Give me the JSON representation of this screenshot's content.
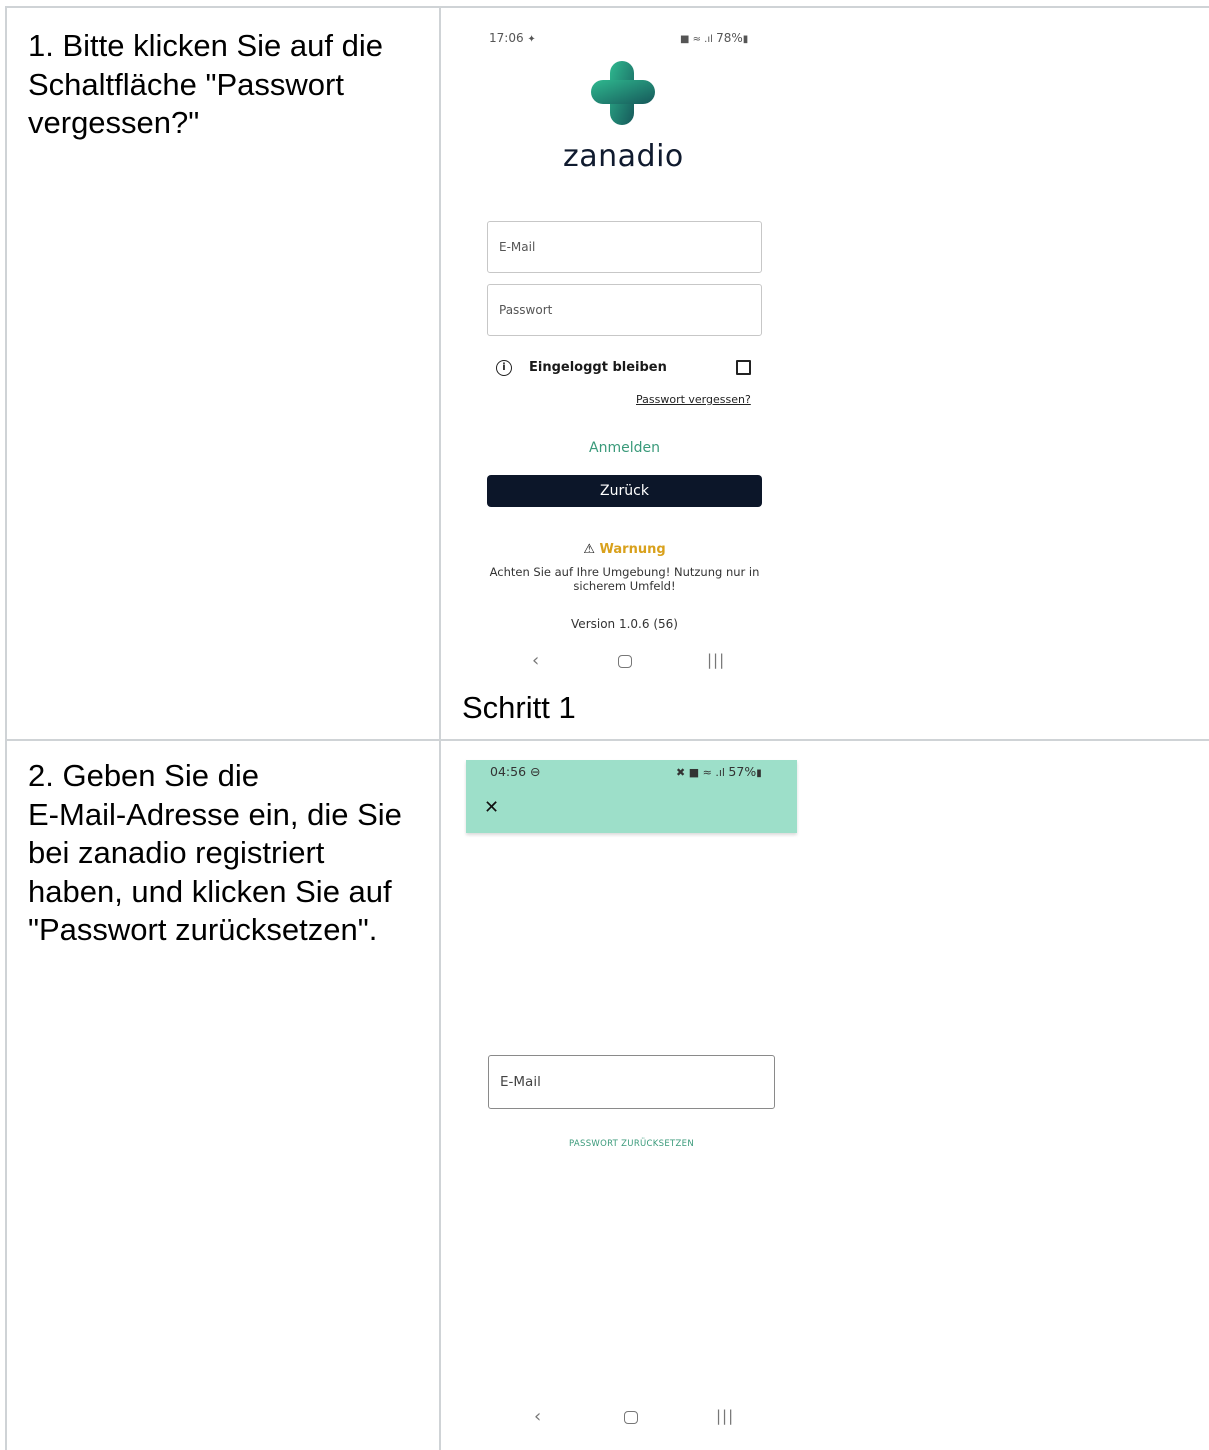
{
  "rows": [
    {
      "instruction_lines": [
        "1. Bitte klicken Sie auf die",
        "Schaltfläche \"Passwort",
        "vergessen?\""
      ],
      "caption": "Schritt 1",
      "screen": {
        "status_time": "17:06",
        "status_right": "78%",
        "app_name": "zanadio",
        "email_placeholder": "E-Mail",
        "password_placeholder": "Passwort",
        "remember_label": "Eingeloggt bleiben",
        "forgot_password": "Passwort vergessen?",
        "login_label": "Anmelden",
        "back_label": "Zurück",
        "warning_title": "Warnung",
        "warning_text_line1": "Achten Sie auf Ihre Umgebung! Nutzung nur in",
        "warning_text_line2": "sicherem Umfeld!",
        "version": "Version 1.0.6 (56)"
      }
    },
    {
      "instruction_lines": [
        "2. Geben Sie die",
        "E-Mail-Adresse ein, die Sie",
        "bei zanadio registriert",
        "haben, und klicken Sie auf",
        "\"Passwort zurücksetzen\"."
      ],
      "screen": {
        "status_time": "04:56",
        "status_right": "57%",
        "email_placeholder": "E-Mail",
        "reset_label": "PASSWORT ZURÜCKSETZEN"
      }
    }
  ],
  "colors": {
    "accent_green": "#3a9a7a",
    "header_green": "#9ddfc9",
    "button_dark": "#0c1629",
    "warning": "#d9a11c",
    "grid": "#cfd3d6"
  },
  "icons": [
    "info-icon",
    "checkbox-icon",
    "warning-icon",
    "close-icon",
    "nav-back-icon",
    "nav-home-icon",
    "nav-recent-icon",
    "logo-cross-icon"
  ]
}
